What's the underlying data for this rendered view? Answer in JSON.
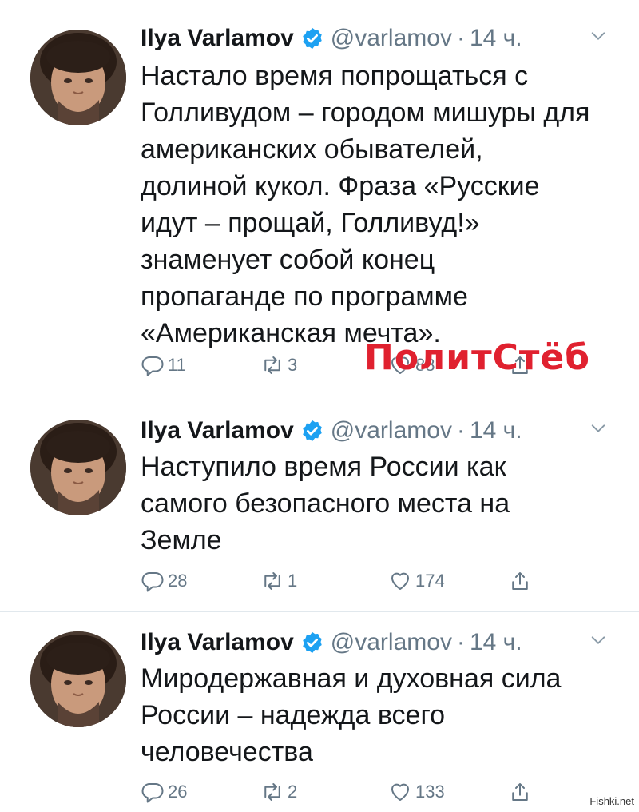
{
  "tweets": [
    {
      "author": "Ilya Varlamov",
      "handle": "@varlamov",
      "time": "14 ч.",
      "text": "Настало время попрощаться с\nГолливудом – городом мишуры для\nамериканских обывателей,\nдолиной кукол. Фраза «Русские\nидут – прощай, Голливуд!»\nзнаменует собой конец\nпропаганде по программе\n«Американская мечта».",
      "replies": "11",
      "retweets": "3",
      "likes": "88"
    },
    {
      "author": "Ilya Varlamov",
      "handle": "@varlamov",
      "time": "14 ч.",
      "text": "Наступило время России как\nсамого безопасного места на\nЗемле",
      "replies": "28",
      "retweets": "1",
      "likes": "174"
    },
    {
      "author": "Ilya Varlamov",
      "handle": "@varlamov",
      "time": "14 ч.",
      "text": "Миродержавная и духовная сила\nРоссии – надежда всего\nчеловечества",
      "replies": "26",
      "retweets": "2",
      "likes": "133"
    }
  ],
  "separator": "·",
  "watermark": "ПолитСтёб",
  "site_mark": "Fishki.net",
  "colors": {
    "verified": "#1da1f2",
    "muted": "#657786",
    "text": "#14171a",
    "watermark": "#e0212f"
  },
  "icons": [
    "verified-badge-icon",
    "chevron-down-icon",
    "reply-icon",
    "retweet-icon",
    "like-icon",
    "share-icon"
  ]
}
